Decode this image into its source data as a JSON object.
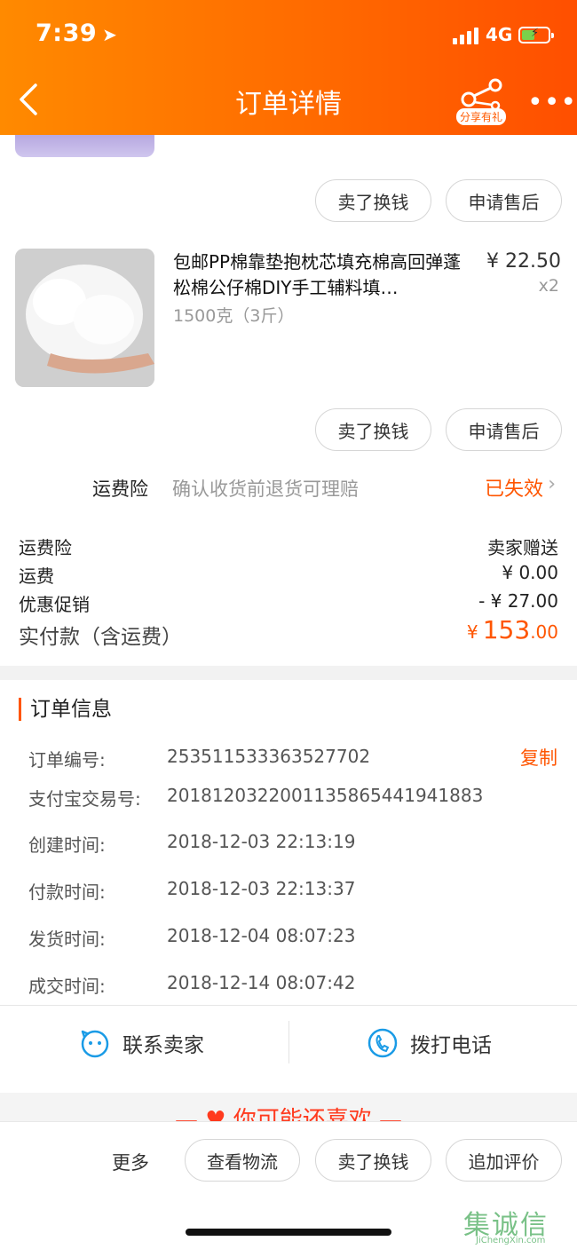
{
  "status_bar": {
    "time": "7:39",
    "network": "4G"
  },
  "header": {
    "title": "订单详情",
    "share_badge": "分享有礼"
  },
  "first_item_actions": {
    "resell": "卖了换钱",
    "after_sales": "申请售后"
  },
  "product": {
    "title": "包邮PP棉靠垫抱枕芯填充棉高回弹蓬松棉公仔棉DIY手工辅料填…",
    "price": "¥ 22.50",
    "quantity": "x2",
    "spec": "1500克（3斤）",
    "actions": {
      "resell": "卖了换钱",
      "after_sales": "申请售后"
    }
  },
  "shipping_insurance": {
    "label": "运费险",
    "description": "确认收货前退货可理赔",
    "status": "已失效"
  },
  "fees": [
    {
      "label": "运费险",
      "value": "卖家赠送"
    },
    {
      "label": "运费",
      "value": "¥ 0.00"
    },
    {
      "label": "优惠促销",
      "value": "- ¥ 27.00"
    }
  ],
  "total": {
    "label": "实付款（含运费）",
    "currency": "¥",
    "integer": "153",
    "decimal": ".00"
  },
  "order_info": {
    "title": "订单信息",
    "copy_label": "复制",
    "rows": [
      {
        "label": "订单编号:",
        "value": "253511533363527702"
      },
      {
        "label": "支付宝交易号:",
        "value": "2018120322001135865441941883"
      },
      {
        "label": "创建时间:",
        "value": "2018-12-03 22:13:19"
      },
      {
        "label": "付款时间:",
        "value": "2018-12-03 22:13:37"
      },
      {
        "label": "发货时间:",
        "value": "2018-12-04 08:07:23"
      },
      {
        "label": "成交时间:",
        "value": "2018-12-14 08:07:42"
      }
    ]
  },
  "contact": {
    "seller": "联系卖家",
    "call": "拨打电话"
  },
  "recommend": {
    "title": "你可能还喜欢"
  },
  "bottom_bar": {
    "more": "更多",
    "logistics": "查看物流",
    "resell": "卖了换钱",
    "review": "追加评价"
  },
  "watermark": {
    "cn": "集诚信",
    "en": "JiChengXin.com"
  }
}
